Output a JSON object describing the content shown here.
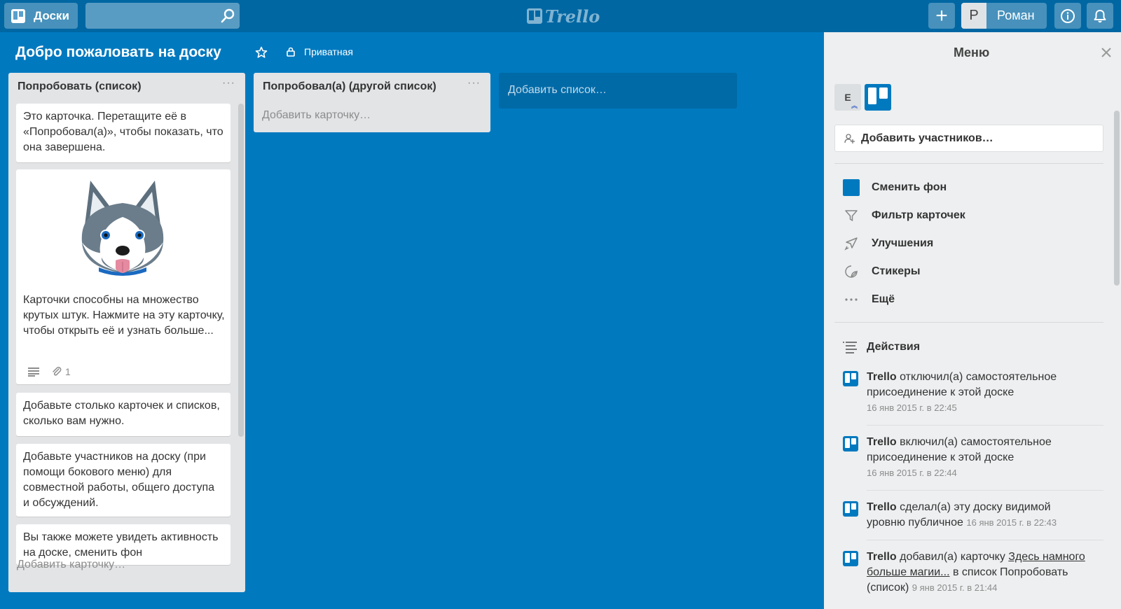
{
  "header": {
    "boards_label": "Доски",
    "search_value": "",
    "logo_text": "Trello",
    "user_initial": "Р",
    "user_name": "Роман"
  },
  "board": {
    "title": "Добро пожаловать на доску",
    "visibility": "Приватная"
  },
  "lists": [
    {
      "title": "Попробовать (список)",
      "menu": "···",
      "cards": [
        "Это карточка. Перетащите её в «Попробовал(а)», чтобы показать, что она завершена.",
        "Карточки способны на множество крутых штук. Нажмите на эту карточку, чтобы открыть её и узнать больше...",
        "Добавьте столько карточек и списков, сколько вам нужно.",
        "Добавьте участников на доску (при помощи бокового меню) для совместной работы, общего доступа и обсуждений.",
        "Вы также можете увидеть активность на доске, сменить фон"
      ],
      "attachment_count": "1",
      "add_card": "Добавить карточку…"
    },
    {
      "title": "Попробовал(а) (другой список)",
      "menu": "···",
      "add_card": "Добавить карточку…"
    }
  ],
  "add_list": "Добавить список…",
  "sidebar": {
    "title": "Меню",
    "member_initial": "E",
    "add_members": "Добавить участников…",
    "menu_items": [
      {
        "label": "Сменить фон",
        "icon": "color-swatch-icon"
      },
      {
        "label": "Фильтр карточек",
        "icon": "filter-icon"
      },
      {
        "label": "Улучшения",
        "icon": "rocket-icon"
      },
      {
        "label": "Стикеры",
        "icon": "sticker-icon"
      },
      {
        "label": "Ещё",
        "icon": "more-icon"
      }
    ],
    "actions_title": "Действия",
    "actions": [
      {
        "author": "Trello",
        "text": " отключил(а) самостоятельное присоединение к этой доске",
        "date": "16 янв 2015 г. в 22:45"
      },
      {
        "author": "Trello",
        "text": " включил(а) самостоятельное присоединение к этой доске",
        "date": "16 янв 2015 г. в 22:44"
      },
      {
        "author": "Trello",
        "text": " сделал(а) эту доску видимой уровню публичное ",
        "date": "16 янв 2015 г. в 22:43"
      },
      {
        "author": "Trello",
        "text": " добавил(а) карточку ",
        "link": "Здесь намного больше магии...",
        "text2": " в список Попробовать (список) ",
        "date": "9 янв 2015 г. в 21:44"
      }
    ]
  },
  "colors": {
    "board_bg": "#0079bf",
    "header_bg": "#0067a3",
    "list_bg": "#e2e4e6",
    "sidebar_bg": "#edeff0"
  }
}
